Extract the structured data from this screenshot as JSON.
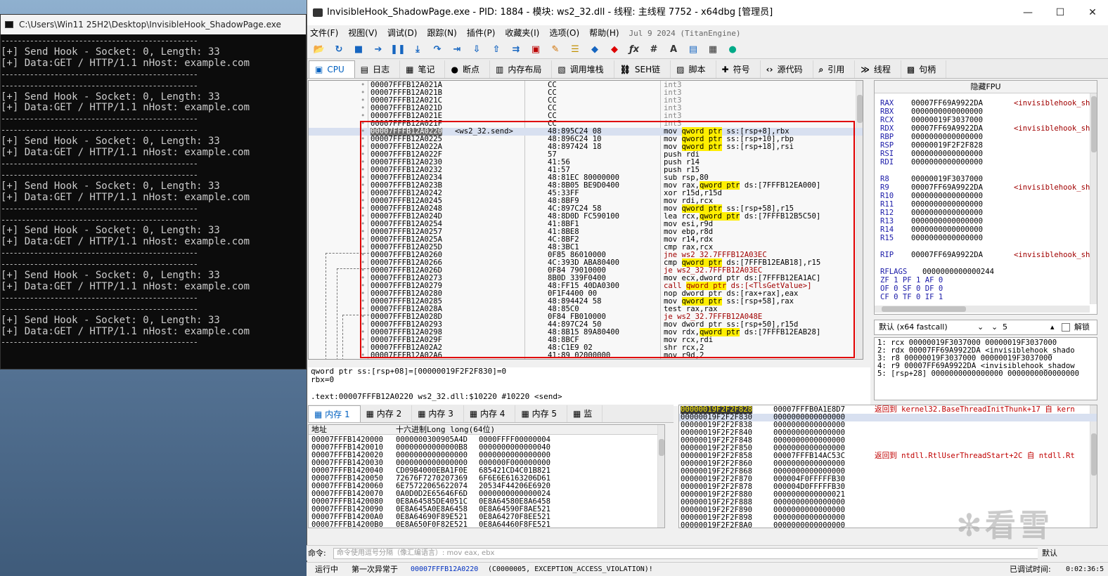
{
  "console": {
    "title": "C:\\Users\\Win11 25H2\\Desktop\\InvisibleHook_ShadowPage.exe",
    "separator": "------------------------------------------------",
    "blocks": [
      {
        "line1": "[+] Send Hook - Socket: 0, Length: 33",
        "line2": "[+] Data:GET / HTTP/1.1 nHost: example.com"
      },
      {
        "line1": "[+] Send Hook - Socket: 0, Length: 33",
        "line2": "[+] Data:GET / HTTP/1.1 nHost: example.com"
      },
      {
        "line1": "[+] Send Hook - Socket: 0, Length: 33",
        "line2": "[+] Data:GET / HTTP/1.1 nHost: example.com"
      },
      {
        "line1": "[+] Send Hook - Socket: 0, Length: 33",
        "line2": "[+] Data:GET / HTTP/1.1 nHost: example.com"
      },
      {
        "line1": "[+] Send Hook - Socket: 0, Length: 33",
        "line2": "[+] Data:GET / HTTP/1.1 nHost: example.com"
      },
      {
        "line1": "[+] Send Hook - Socket: 0, Length: 33",
        "line2": "[+] Data:GET / HTTP/1.1 nHost: example.com"
      },
      {
        "line1": "[+] Send Hook - Socket: 0, Length: 33",
        "line2": "[+] Data:GET / HTTP/1.1 nHost: example.com"
      }
    ]
  },
  "debugger": {
    "title": "InvisibleHook_ShadowPage.exe - PID: 1884 - 模块: ws2_32.dll - 线程: 主线程 7752 - x64dbg [管理员]",
    "window_buttons": {
      "minimize": "—",
      "maximize": "☐",
      "close": "✕"
    },
    "menu": [
      "文件(F)",
      "视图(V)",
      "调试(D)",
      "跟踪(N)",
      "插件(P)",
      "收藏夹(I)",
      "选项(O)",
      "帮助(H)"
    ],
    "version": "Jul 9 2024 (TitanEngine)",
    "tabs": [
      "CPU",
      "日志",
      "笔记",
      "断点",
      "内存布局",
      "调用堆栈",
      "SEH链",
      "脚本",
      "符号",
      "源代码",
      "引用",
      "线程",
      "句柄"
    ],
    "disasm_rows": [
      {
        "addr": "00007FFFB12A021A",
        "label": "",
        "bytes": "CC",
        "ins": "int3",
        "style": "gray"
      },
      {
        "addr": "00007FFFB12A021B",
        "label": "",
        "bytes": "CC",
        "ins": "int3",
        "style": "gray"
      },
      {
        "addr": "00007FFFB12A021C",
        "label": "",
        "bytes": "CC",
        "ins": "int3",
        "style": "gray"
      },
      {
        "addr": "00007FFFB12A021D",
        "label": "",
        "bytes": "CC",
        "ins": "int3",
        "style": "gray"
      },
      {
        "addr": "00007FFFB12A021E",
        "label": "",
        "bytes": "CC",
        "ins": "int3",
        "style": "gray"
      },
      {
        "addr": "00007FFFB12A021F",
        "label": "",
        "bytes": "CC",
        "ins": "int3",
        "style": "gray"
      },
      {
        "addr": "00007FFFB12A0220",
        "label": "<ws2_32.send>",
        "bytes": "48:895C24 08",
        "ins": "mov qword ptr ss:[rsp+8],rbx",
        "style": "cur"
      },
      {
        "addr": "00007FFFB12A0225",
        "label": "",
        "bytes": "48:896C24 10",
        "ins": "mov qword ptr ss:[rsp+10],rbp",
        "style": ""
      },
      {
        "addr": "00007FFFB12A022A",
        "label": "",
        "bytes": "48:897424 18",
        "ins": "mov qword ptr ss:[rsp+18],rsi",
        "style": ""
      },
      {
        "addr": "00007FFFB12A022F",
        "label": "",
        "bytes": "57",
        "ins": "push rdi",
        "style": ""
      },
      {
        "addr": "00007FFFB12A0230",
        "label": "",
        "bytes": "41:56",
        "ins": "push r14",
        "style": ""
      },
      {
        "addr": "00007FFFB12A0232",
        "label": "",
        "bytes": "41:57",
        "ins": "push r15",
        "style": ""
      },
      {
        "addr": "00007FFFB12A0234",
        "label": "",
        "bytes": "48:81EC 80000000",
        "ins": "sub rsp,80",
        "style": ""
      },
      {
        "addr": "00007FFFB12A023B",
        "label": "",
        "bytes": "48:8B05 BE9D0400",
        "ins": "mov rax,qword ptr ds:[7FFFB12EA000]",
        "style": ""
      },
      {
        "addr": "00007FFFB12A0242",
        "label": "",
        "bytes": "45:33FF",
        "ins": "xor r15d,r15d",
        "style": ""
      },
      {
        "addr": "00007FFFB12A0245",
        "label": "",
        "bytes": "48:8BF9",
        "ins": "mov rdi,rcx",
        "style": ""
      },
      {
        "addr": "00007FFFB12A0248",
        "label": "",
        "bytes": "4C:897C24 58",
        "ins": "mov qword ptr ss:[rsp+58],r15",
        "style": ""
      },
      {
        "addr": "00007FFFB12A024D",
        "label": "",
        "bytes": "48:8D0D FC590100",
        "ins": "lea rcx,qword ptr ds:[7FFFB12B5C50]",
        "style": ""
      },
      {
        "addr": "00007FFFB12A0254",
        "label": "",
        "bytes": "41:8BF1",
        "ins": "mov esi,r9d",
        "style": ""
      },
      {
        "addr": "00007FFFB12A0257",
        "label": "",
        "bytes": "41:8BE8",
        "ins": "mov ebp,r8d",
        "style": ""
      },
      {
        "addr": "00007FFFB12A025A",
        "label": "",
        "bytes": "4C:8BF2",
        "ins": "mov r14,rdx",
        "style": ""
      },
      {
        "addr": "00007FFFB12A025D",
        "label": "",
        "bytes": "48:3BC1",
        "ins": "cmp rax,rcx",
        "style": ""
      },
      {
        "addr": "00007FFFB12A0260",
        "label": "",
        "bytes": "0F85 86010000",
        "ins": "jne ws2_32.7FFFB12A03EC",
        "style": "jmp"
      },
      {
        "addr": "00007FFFB12A0266",
        "label": "",
        "bytes": "4C:393D ABA80400",
        "ins": "cmp qword ptr ds:[7FFFB12EAB18],r15",
        "style": ""
      },
      {
        "addr": "00007FFFB12A026D",
        "label": "",
        "bytes": "0F84 79010000",
        "ins": "je ws2_32.7FFFB12A03EC",
        "style": "jmp"
      },
      {
        "addr": "00007FFFB12A0273",
        "label": "",
        "bytes": "8B0D 339F0400",
        "ins": "mov ecx,dword ptr ds:[7FFFB12EA1AC]",
        "style": ""
      },
      {
        "addr": "00007FFFB12A0279",
        "label": "",
        "bytes": "48:FF15 40DA0300",
        "ins": "call qword ptr ds:[<TlsGetValue>]",
        "style": "call"
      },
      {
        "addr": "00007FFFB12A0280",
        "label": "",
        "bytes": "0F1F4400 00",
        "ins": "nop dword ptr ds:[rax+rax],eax",
        "style": ""
      },
      {
        "addr": "00007FFFB12A0285",
        "label": "",
        "bytes": "48:894424 58",
        "ins": "mov qword ptr ss:[rsp+58],rax",
        "style": ""
      },
      {
        "addr": "00007FFFB12A028A",
        "label": "",
        "bytes": "48:85C0",
        "ins": "test rax,rax",
        "style": ""
      },
      {
        "addr": "00007FFFB12A028D",
        "label": "",
        "bytes": "0F84 FB010000",
        "ins": "je ws2_32.7FFFB12A048E",
        "style": "jmp"
      },
      {
        "addr": "00007FFFB12A0293",
        "label": "",
        "bytes": "44:897C24 50",
        "ins": "mov dword ptr ss:[rsp+50],r15d",
        "style": ""
      },
      {
        "addr": "00007FFFB12A0298",
        "label": "",
        "bytes": "48:8B15 89A80400",
        "ins": "mov rdx,qword ptr ds:[7FFFB12EAB28]",
        "style": ""
      },
      {
        "addr": "00007FFFB12A029F",
        "label": "",
        "bytes": "48:8BCF",
        "ins": "mov rcx,rdi",
        "style": ""
      },
      {
        "addr": "00007FFFB12A02A2",
        "label": "",
        "bytes": "48:C1E9 02",
        "ins": "shr rcx,2",
        "style": ""
      },
      {
        "addr": "00007FFFB12A02A6",
        "label": "",
        "bytes": "41:89 02000000",
        "ins": "mov r9d,2",
        "style": ""
      }
    ],
    "registers_header": "隐藏FPU",
    "registers": [
      {
        "name": "RAX",
        "value": "00007FF69A9922DA",
        "comment": "<invisiblehook_sh"
      },
      {
        "name": "RBX",
        "value": "0000000000000000",
        "comment": ""
      },
      {
        "name": "RCX",
        "value": "00000019F3037000",
        "comment": ""
      },
      {
        "name": "RDX",
        "value": "00007FF69A9922DA",
        "comment": "<invisiblehook_sh"
      },
      {
        "name": "RBP",
        "value": "0000000000000000",
        "comment": ""
      },
      {
        "name": "RSP",
        "value": "00000019F2F2F828",
        "comment": ""
      },
      {
        "name": "RSI",
        "value": "0000000000000000",
        "comment": ""
      },
      {
        "name": "RDI",
        "value": "0000000000000000",
        "comment": ""
      },
      {
        "name": "R8",
        "value": "00000019F3037000",
        "comment": ""
      },
      {
        "name": "R9",
        "value": "00007FF69A9922DA",
        "comment": "<invisiblehook_sh"
      },
      {
        "name": "R10",
        "value": "0000000000000000",
        "comment": ""
      },
      {
        "name": "R11",
        "value": "0000000000000000",
        "comment": ""
      },
      {
        "name": "R12",
        "value": "0000000000000000",
        "comment": ""
      },
      {
        "name": "R13",
        "value": "0000000000000000",
        "comment": ""
      },
      {
        "name": "R14",
        "value": "0000000000000000",
        "comment": ""
      },
      {
        "name": "R15",
        "value": "0000000000000000",
        "comment": ""
      },
      {
        "name": "RIP",
        "value": "00007FF69A9922DA",
        "comment": "<invisiblehook_sh"
      }
    ],
    "rflags": {
      "name": "RFLAGS",
      "value": "0000000000000244"
    },
    "flags_lines": [
      "ZF 1  PF 1  AF 0",
      "OF 0  SF 0  DF 0",
      "CF 0  TF 0  IF 1"
    ],
    "info_lines": [
      "qword ptr ss:[rsp+08]=[00000019F2F2F830]=0",
      "rbx=0",
      "",
      ".text:00007FFFB12A0220 ws2_32.dll:$10220 #10220 <send>"
    ],
    "call_convention": "默认 (x64 fastcall)",
    "arg_count": "5",
    "unlock_label": "解锁",
    "args": [
      "1: rcx 00000019F3037000 00000019F3037000",
      "2: rdx 00007FF69A9922DA <invisiblehook_shado",
      "3: r8 00000019F3037000 00000019F3037000",
      "4: r9 00007FF69A9922DA <invisiblehook_shadow",
      "5: [rsp+28] 0000000000000000 0000000000000000"
    ],
    "dump_tabs": [
      "内存 1",
      "内存 2",
      "内存 3",
      "内存 4",
      "内存 5",
      "监"
    ],
    "dump_headers": {
      "addr": "地址",
      "hex": "十六进制Long long(64位)"
    },
    "dump_rows": [
      {
        "addr": "00007FFFB1420000",
        "v1": "0000000300905A4D",
        "v2": "0000FFFF00000004"
      },
      {
        "addr": "00007FFFB1420010",
        "v1": "00000000000000B8",
        "v2": "0000000000000040"
      },
      {
        "addr": "00007FFFB1420020",
        "v1": "0000000000000000",
        "v2": "0000000000000000"
      },
      {
        "addr": "00007FFFB1420030",
        "v1": "0000000000000000",
        "v2": "000000F000000000"
      },
      {
        "addr": "00007FFFB1420040",
        "v1": "CD09B4000EBA1F0E",
        "v2": "685421CD4C01B821"
      },
      {
        "addr": "00007FFFB1420050",
        "v1": "72676F7270207369",
        "v2": "6F6E6E6163206D61"
      },
      {
        "addr": "00007FFFB1420060",
        "v1": "6E75722065622074",
        "v2": "20534F44206E6920"
      },
      {
        "addr": "00007FFFB1420070",
        "v1": "0A0D0D2E65646F6D",
        "v2": "0000000000000024"
      },
      {
        "addr": "00007FFFB1420080",
        "v1": "0E8A64585DE4051C",
        "v2": "0E8A64580E8A6458"
      },
      {
        "addr": "00007FFFB1420090",
        "v1": "0E8A645A0E8A6458",
        "v2": "0E8A64590F8AE521"
      },
      {
        "addr": "00007FFFB14200A0",
        "v1": "0E8A64690F89E521",
        "v2": "0E8A64270F8EE521"
      },
      {
        "addr": "00007FFFB14200B0",
        "v1": "0E8A650F0F82E521",
        "v2": "0E8A64460F8FE521"
      }
    ],
    "stack_rows": [
      {
        "addr": "00000019F2F2F828",
        "val": "00007FFFB0A1E8D7",
        "cm": "返回到 kernel32.BaseThreadInitThunk+17 自 kern"
      },
      {
        "addr": "00000019F2F2F830",
        "val": "0000000000000000",
        "cm": ""
      },
      {
        "addr": "00000019F2F2F838",
        "val": "0000000000000000",
        "cm": ""
      },
      {
        "addr": "00000019F2F2F840",
        "val": "0000000000000000",
        "cm": ""
      },
      {
        "addr": "00000019F2F2F848",
        "val": "0000000000000000",
        "cm": ""
      },
      {
        "addr": "00000019F2F2F850",
        "val": "0000000000000000",
        "cm": ""
      },
      {
        "addr": "00000019F2F2F858",
        "val": "00007FFFB14AC53C",
        "cm": "返回到 ntdll.RtlUserThreadStart+2C 自 ntdll.Rt"
      },
      {
        "addr": "00000019F2F2F860",
        "val": "0000000000000000",
        "cm": ""
      },
      {
        "addr": "00000019F2F2F868",
        "val": "0000000000000000",
        "cm": ""
      },
      {
        "addr": "00000019F2F2F870",
        "val": "000004F0FFFFFB30",
        "cm": ""
      },
      {
        "addr": "00000019F2F2F878",
        "val": "000004D0FFFFFB30",
        "cm": ""
      },
      {
        "addr": "00000019F2F2F880",
        "val": "0000000000000021",
        "cm": ""
      },
      {
        "addr": "00000019F2F2F888",
        "val": "0000000000000000",
        "cm": ""
      },
      {
        "addr": "00000019F2F2F890",
        "val": "0000000000000000",
        "cm": ""
      },
      {
        "addr": "00000019F2F2F898",
        "val": "0000000000000000",
        "cm": ""
      },
      {
        "addr": "00000019F2F2F8A0",
        "val": "0000000000000000",
        "cm": ""
      }
    ],
    "command_label": "命令:",
    "command_placeholder": "命令使用逗号分隔（像汇编语言）: mov eax, ebx",
    "default_label": "默认",
    "status": {
      "state": "运行中",
      "message_prefix": "第一次异常于",
      "address": "00007FFFB12A0220",
      "message_suffix": "(C0000005, EXCEPTION_ACCESS_VIOLATION)!",
      "time_label": "已调试时间:",
      "time_value": "0:02:36:5"
    },
    "watermark": "看雪"
  }
}
